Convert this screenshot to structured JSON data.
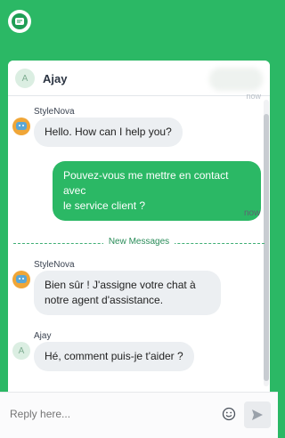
{
  "header": {
    "avatar_initial": "A",
    "contact_name": "Ajay",
    "faint_time": "now"
  },
  "messages": [
    {
      "sender": "StyleNova",
      "text": "Hello. How can I help you?",
      "direction": "incoming",
      "avatar_icon": "bot-avatar-icon"
    },
    {
      "text_line1": "Pouvez-vous me mettre en contact avec",
      "text_line2": "le service client ?",
      "direction": "outgoing",
      "time": "now"
    },
    {
      "sender": "StyleNova",
      "text_line1": "Bien sûr ! J'assigne votre chat à",
      "text_line2": "notre agent d'assistance.",
      "direction": "incoming",
      "avatar_icon": "bot-avatar-icon"
    },
    {
      "sender": "Ajay",
      "avatar_initial": "A",
      "text": "Hé, comment puis-je t'aider ?",
      "direction": "incoming"
    }
  ],
  "divider": {
    "label": "New Messages"
  },
  "composer": {
    "placeholder": "Reply here...",
    "emoji_icon": "emoji-icon",
    "send_icon": "send-icon"
  },
  "colors": {
    "brand_green": "#2bb865",
    "incoming_bubble": "#eceff2",
    "divider_green": "#2b8d5a"
  }
}
